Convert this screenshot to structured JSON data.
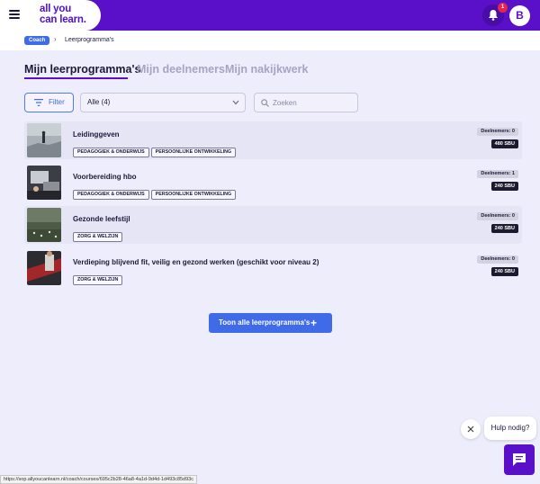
{
  "header": {
    "logo_lines": [
      "all you",
      "can learn."
    ],
    "notification_count": "1",
    "avatar_initial": "B"
  },
  "breadcrumb": {
    "role_badge": "Coach",
    "separator": "›",
    "current": "Leerprogramma's"
  },
  "tabs": [
    {
      "label": "Mijn leerprogramma's",
      "active": true
    },
    {
      "label": "Mijn deelnemers",
      "active": false
    },
    {
      "label": "Mijn nakijkwerk",
      "active": false
    }
  ],
  "controls": {
    "filter_label": "Filter",
    "select_value": "Alle (4)",
    "search_placeholder": "Zoeken"
  },
  "programs": [
    {
      "title": "Leidinggeven",
      "tags": [
        "PEDAGOGIEK & ONDERWIJS",
        "PERSOONLIJKE ONTWIKKELING"
      ],
      "participants": "Deelnemers: 0",
      "sbu": "480 SBU"
    },
    {
      "title": "Voorbereiding hbo",
      "tags": [
        "PEDAGOGIEK & ONDERWIJS",
        "PERSOONLIJKE ONTWIKKELING"
      ],
      "participants": "Deelnemers: 1",
      "sbu": "240 SBU"
    },
    {
      "title": "Gezonde leefstijl",
      "tags": [
        "ZORG & WELZIJN"
      ],
      "participants": "Deelnemers: 0",
      "sbu": "240 SBU"
    },
    {
      "title": "Verdieping blijvend fit, veilig en gezond werken (geschikt voor niveau 2)",
      "tags": [
        "ZORG & WELZIJN"
      ],
      "participants": "Deelnemers: 0",
      "sbu": "240 SBU"
    }
  ],
  "show_all": {
    "label": "Toon alle leerprogramma's",
    "icon": "+"
  },
  "help": {
    "label": "Hulp nodig?"
  },
  "status_url": "https://sop.allyoucanlearn.nl/coach/courses/695c2b28-46a8-4a1d-9d4d-1d493c85d93c",
  "colors": {
    "brand": "#5a0fc8",
    "primary": "#3f6be8",
    "background": "#eeedfb"
  },
  "icons": [
    "hamburger-icon",
    "bell-icon",
    "chevron-right-icon",
    "filter-icon",
    "chevron-down-icon",
    "search-icon",
    "plus-icon",
    "close-icon",
    "chat-icon"
  ]
}
